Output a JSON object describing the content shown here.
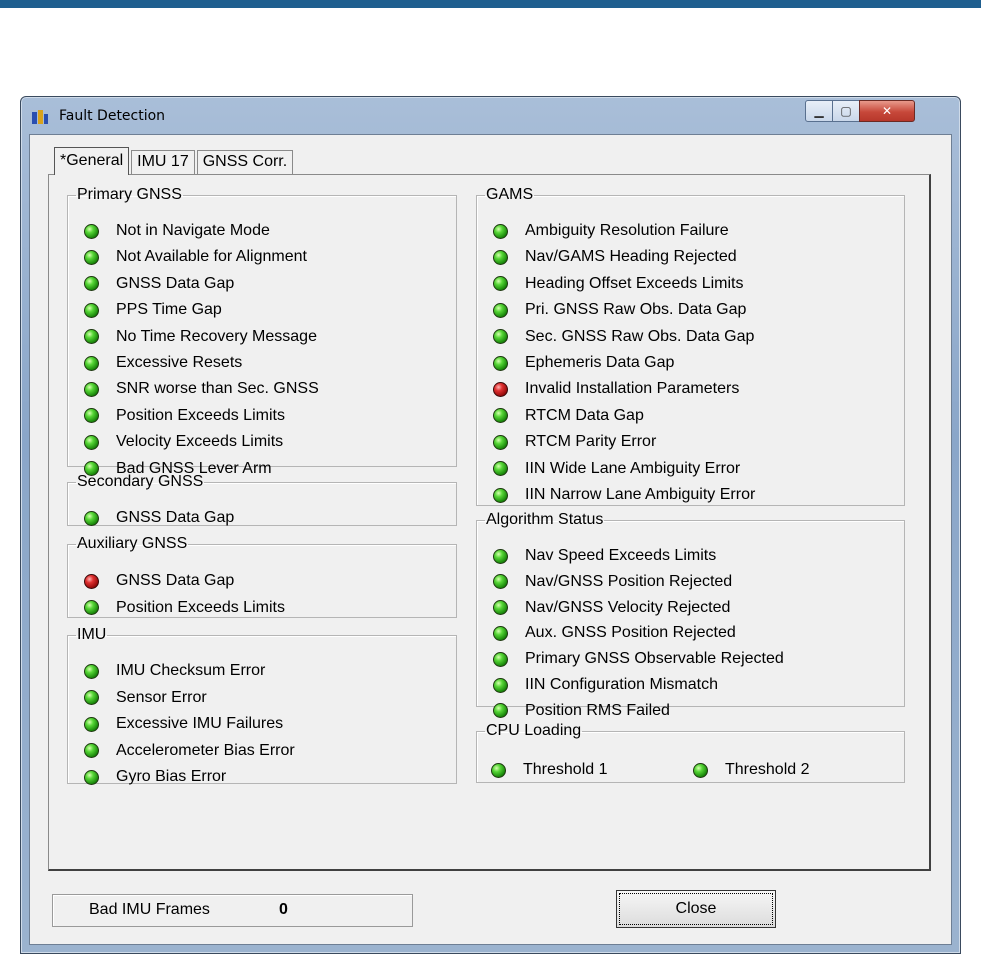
{
  "window": {
    "title": "Fault Detection"
  },
  "controls": {
    "minimize": "▁",
    "maximize": "▢",
    "close": "✕"
  },
  "tabs": [
    "*General",
    "IMU 17",
    "GNSS Corr."
  ],
  "groups": {
    "primary_gnss": {
      "title": "Primary GNSS",
      "items": [
        {
          "label": "Not in Navigate Mode",
          "status": "ok"
        },
        {
          "label": "Not Available for Alignment",
          "status": "ok"
        },
        {
          "label": "GNSS Data Gap",
          "status": "ok"
        },
        {
          "label": "PPS Time Gap",
          "status": "ok"
        },
        {
          "label": "No Time Recovery Message",
          "status": "ok"
        },
        {
          "label": "Excessive Resets",
          "status": "ok"
        },
        {
          "label": "SNR worse than Sec. GNSS",
          "status": "ok"
        },
        {
          "label": "Position Exceeds Limits",
          "status": "ok"
        },
        {
          "label": "Velocity Exceeds Limits",
          "status": "ok"
        },
        {
          "label": "Bad GNSS Lever Arm",
          "status": "ok"
        }
      ]
    },
    "secondary_gnss": {
      "title": "Secondary GNSS",
      "items": [
        {
          "label": "GNSS Data Gap",
          "status": "ok"
        }
      ]
    },
    "auxiliary_gnss": {
      "title": "Auxiliary GNSS",
      "items": [
        {
          "label": "GNSS Data Gap",
          "status": "fault"
        },
        {
          "label": "Position Exceeds Limits",
          "status": "ok"
        }
      ]
    },
    "imu": {
      "title": "IMU",
      "items": [
        {
          "label": "IMU Checksum Error",
          "status": "ok"
        },
        {
          "label": "Sensor Error",
          "status": "ok"
        },
        {
          "label": "Excessive IMU Failures",
          "status": "ok"
        },
        {
          "label": "Accelerometer Bias Error",
          "status": "ok"
        },
        {
          "label": "Gyro Bias Error",
          "status": "ok"
        }
      ]
    },
    "gams": {
      "title": "GAMS",
      "items": [
        {
          "label": "Ambiguity Resolution Failure",
          "status": "ok"
        },
        {
          "label": "Nav/GAMS Heading Rejected",
          "status": "ok"
        },
        {
          "label": "Heading Offset Exceeds Limits",
          "status": "ok"
        },
        {
          "label": "Pri. GNSS Raw Obs. Data Gap",
          "status": "ok"
        },
        {
          "label": "Sec. GNSS Raw Obs. Data Gap",
          "status": "ok"
        },
        {
          "label": "Ephemeris Data Gap",
          "status": "ok"
        },
        {
          "label": "Invalid Installation Parameters",
          "status": "fault"
        },
        {
          "label": "RTCM Data Gap",
          "status": "ok"
        },
        {
          "label": "RTCM Parity Error",
          "status": "ok"
        },
        {
          "label": "IIN Wide Lane Ambiguity Error",
          "status": "ok"
        },
        {
          "label": "IIN Narrow Lane Ambiguity Error",
          "status": "ok"
        }
      ]
    },
    "algorithm_status": {
      "title": "Algorithm Status",
      "items": [
        {
          "label": "Nav Speed Exceeds Limits",
          "status": "ok"
        },
        {
          "label": "Nav/GNSS Position Rejected",
          "status": "ok"
        },
        {
          "label": "Nav/GNSS Velocity Rejected",
          "status": "ok"
        },
        {
          "label": "Aux. GNSS Position Rejected",
          "status": "ok"
        },
        {
          "label": "Primary GNSS Observable Rejected",
          "status": "ok"
        },
        {
          "label": "IIN Configuration Mismatch",
          "status": "ok"
        },
        {
          "label": "Position RMS Failed",
          "status": "ok"
        }
      ]
    },
    "cpu_loading": {
      "title": "CPU Loading",
      "items": [
        {
          "label": "Threshold 1",
          "status": "ok"
        },
        {
          "label": "Threshold 2",
          "status": "ok"
        }
      ]
    }
  },
  "footer": {
    "bad_imu_frames_label": "Bad IMU Frames",
    "bad_imu_frames_value": "0"
  },
  "buttons": {
    "close": "Close"
  },
  "colors": {
    "ok": "#2fb51c",
    "fault": "#c41a1a",
    "title_bar": "#9bb3cf",
    "top_bar": "#1f5f8f"
  }
}
